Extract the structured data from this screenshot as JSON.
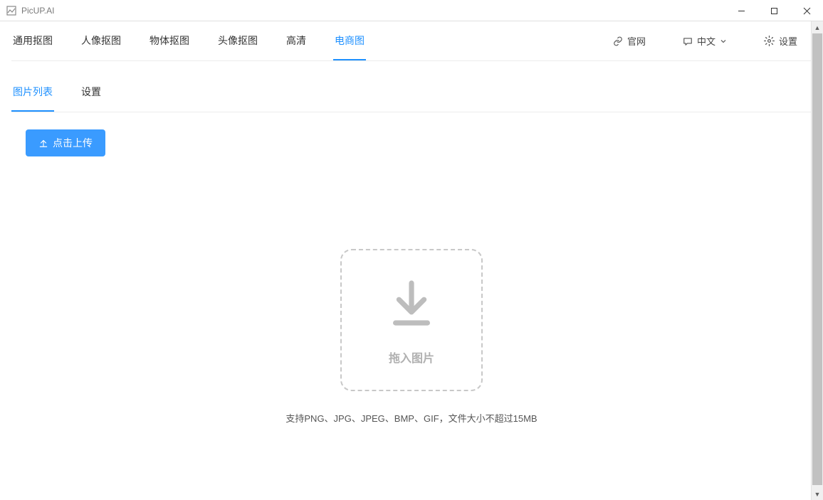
{
  "app": {
    "title": "PicUP.AI"
  },
  "nav": {
    "tabs": [
      {
        "label": "通用抠图",
        "active": false
      },
      {
        "label": "人像抠图",
        "active": false
      },
      {
        "label": "物体抠图",
        "active": false
      },
      {
        "label": "头像抠图",
        "active": false
      },
      {
        "label": "高清",
        "active": false
      },
      {
        "label": "电商图",
        "active": true
      }
    ],
    "right": {
      "official": "官网",
      "language": "中文",
      "settings": "设置"
    }
  },
  "subnav": {
    "tabs": [
      {
        "label": "图片列表",
        "active": true
      },
      {
        "label": "设置",
        "active": false
      }
    ]
  },
  "upload": {
    "button_label": "点击上传",
    "dropzone_label": "拖入图片",
    "hint": "支持PNG、JPG、JPEG、BMP、GIF，文件大小不超过15MB"
  }
}
